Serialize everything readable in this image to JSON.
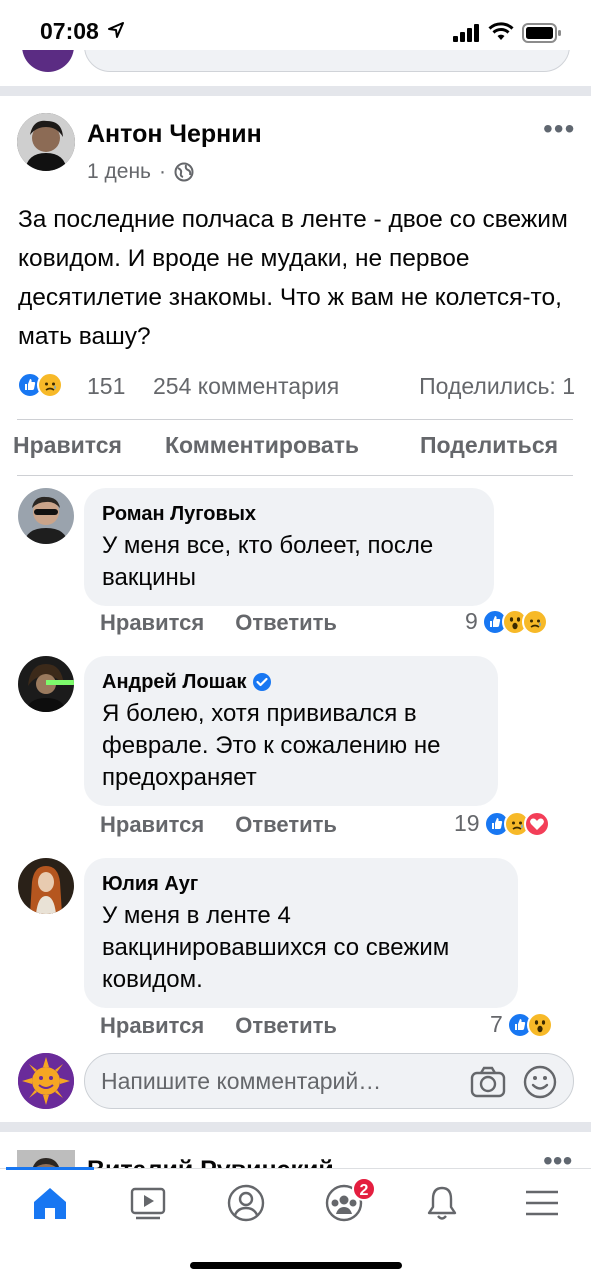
{
  "status_bar": {
    "time": "07:08"
  },
  "post": {
    "author": "Антон Чернин",
    "age": "1 день",
    "dot": "·",
    "text": "За последние полчаса в ленте - двое со свежим ковидом. И вроде не мудаки, не первое десятилетие знакомы. Что ж вам не колется-то, мать вашу?",
    "reactions_count": "151",
    "comments_count": "254 комментария",
    "shares": "Поделились: 1",
    "actions": {
      "like": "Нравится",
      "comment": "Комментировать",
      "share": "Поделиться"
    }
  },
  "comments": [
    {
      "author": "Роман Луговых",
      "text": "У меня все, кто болеет, после вакцины",
      "like": "Нравится",
      "reply": "Ответить",
      "reaction_count": "9",
      "reactions": [
        "like-icon",
        "wow-icon",
        "sad-icon"
      ]
    },
    {
      "author": "Андрей Лошак",
      "verified": true,
      "text": "Я болею, хотя прививался в феврале. Это к сожалению не предохраняет",
      "like": "Нравится",
      "reply": "Ответить",
      "reaction_count": "19",
      "reactions": [
        "like-icon",
        "sad-icon",
        "love-icon"
      ]
    },
    {
      "author": "Юлия Ауг",
      "text": "У меня в ленте 4 вакцинировавшихся со свежим ковидом.",
      "like": "Нравится",
      "reply": "Ответить",
      "reaction_count": "7",
      "reactions": [
        "like-icon",
        "wow-icon"
      ]
    }
  ],
  "write_comment": {
    "placeholder": "Напишите комментарий…"
  },
  "next_post": {
    "author": "Виталий Рувинский"
  },
  "tabbar": {
    "items": [
      "home-icon",
      "watch-icon",
      "profile-icon",
      "groups-icon",
      "notifications-icon",
      "menu-icon"
    ],
    "groups_badge": "2",
    "accent": "#1877f2"
  }
}
